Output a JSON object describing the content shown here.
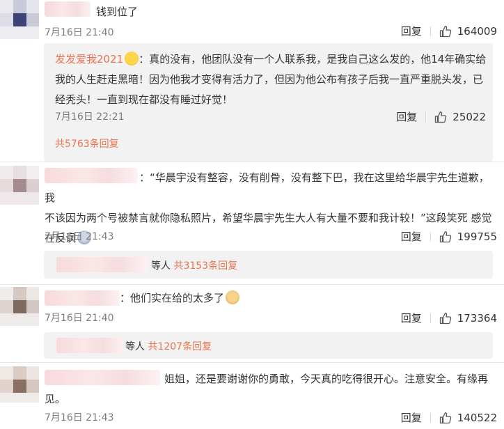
{
  "comments": [
    {
      "text": "钱到位了",
      "time": "7月16日 21:40",
      "reply_label": "回复",
      "likes": "164009",
      "sub_reply": {
        "author": "发发爱我2021",
        "text": "：真的没有，他团队没有一个人联系我，是我自己这么发的，他14年确实给我的人生赶走黑暗！因为他我才变得有活力了，但因为他公布有孩子后我一直严重脱头发，已经秃头！一直到现在都没有睡过好觉！",
        "line1": "：真的没有，他团队没有一个人联系我，是我自己这么发的，他14年确实给",
        "line2": "我的人生赶走黑暗！因为他我才变得有活力了，但因为他公布有孩子后我一直严重脱头发，已",
        "line3": "经秃头！一直到现在都没有睡过好觉！",
        "time": "7月16日 22:21",
        "reply_label": "回复",
        "likes": "25022",
        "more_replies": "共5763条回复"
      }
    },
    {
      "line1": "：“华晨宇没有整容，没有削骨，没有整下巴，我在这里给华晨宇先生道歉，我",
      "line2": "不该因为两个号被禁言就你隐私照片，希望华晨宇先生大人有大量不要和我计较！”这段笑死 感觉",
      "line3": "在反讽",
      "time": "7月16日 21:43",
      "reply_label": "回复",
      "likes": "199755",
      "replies_prefix": "等人",
      "replies_count": "共3153条回复"
    },
    {
      "text": "：他们实在给的太多了",
      "time": "7月16日 21:40",
      "reply_label": "回复",
      "likes": "173364",
      "replies_prefix": "等人",
      "replies_count": "共1207条回复"
    },
    {
      "line1": "姐姐，还是要谢谢你的勇敢，今天真的吃得很开心。注意安全。有缘再",
      "line2": "见。",
      "time": "7月16日 21:43",
      "reply_label": "回复",
      "likes": "140522"
    }
  ],
  "icons": {
    "like": "thumbs-up-icon",
    "emoji_shock": "shocked-face-emoji",
    "emoji_doge": "doge-emoji",
    "emoji_cry": "crying-laughing-emoji"
  },
  "colors": {
    "link": "#eb7350",
    "meta": "#7c7c7c",
    "reply_bg": "#f2f2f2",
    "blur_name": "#f7d9dc"
  }
}
